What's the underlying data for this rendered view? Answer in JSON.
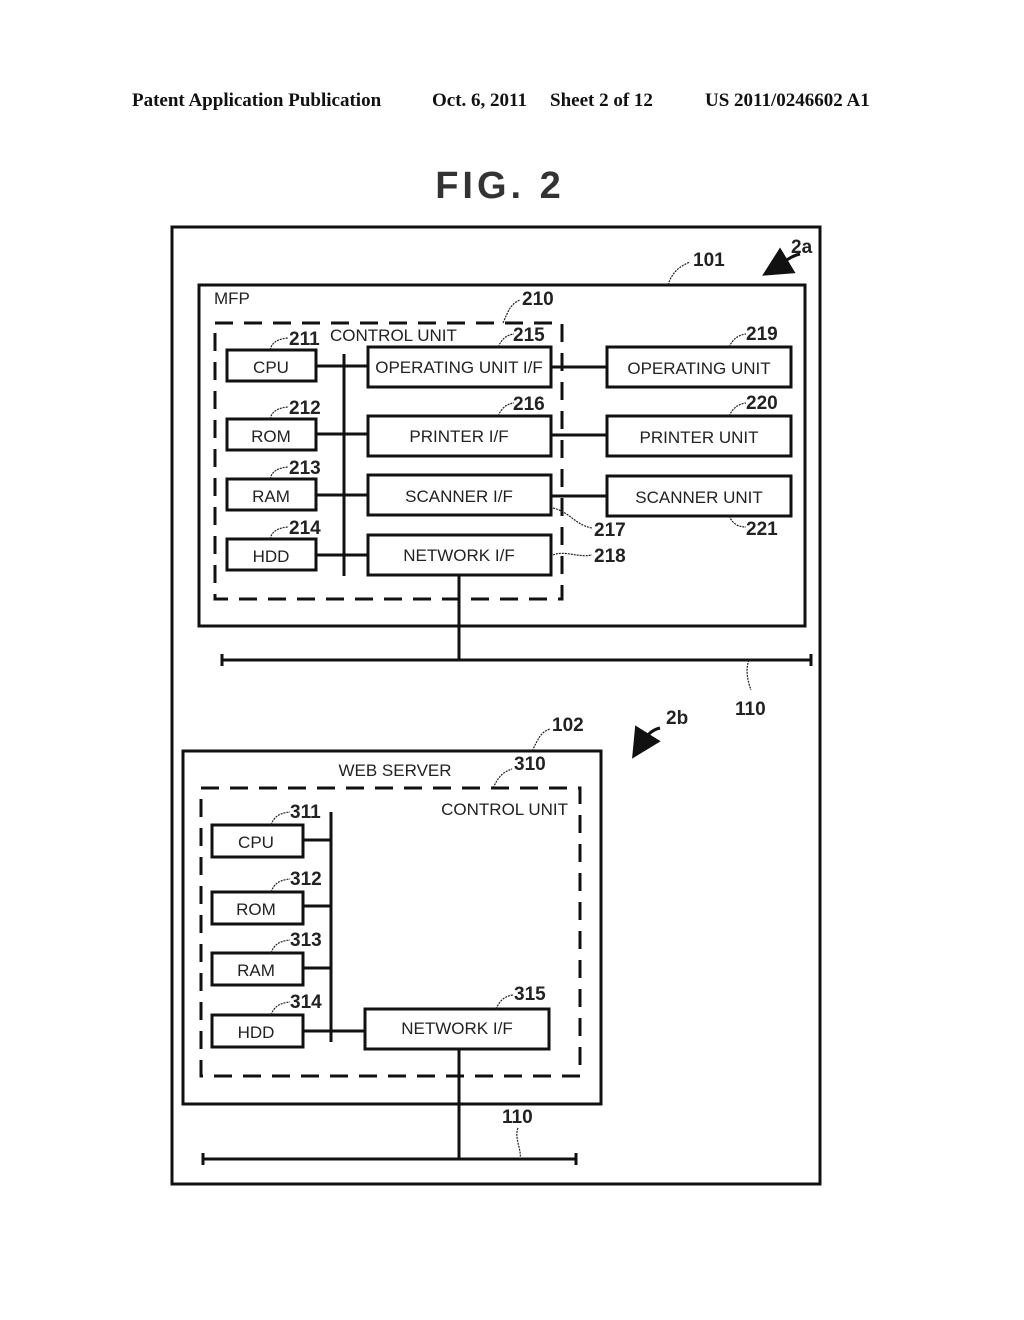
{
  "header": {
    "publication": "Patent Application Publication",
    "date": "Oct. 6, 2011",
    "sheet": "Sheet 2 of 12",
    "patent_number": "US 2011/0246602 A1"
  },
  "figure": {
    "title": "FIG. 2",
    "view_a": {
      "ref": "2a",
      "device": {
        "label": "MFP",
        "ref": "101"
      },
      "control_unit": {
        "label": "CONTROL UNIT",
        "ref": "210"
      },
      "components": [
        {
          "label": "CPU",
          "ref": "211"
        },
        {
          "label": "ROM",
          "ref": "212"
        },
        {
          "label": "RAM",
          "ref": "213"
        },
        {
          "label": "HDD",
          "ref": "214"
        }
      ],
      "interfaces": [
        {
          "label": "OPERATING UNIT I/F",
          "ref": "215"
        },
        {
          "label": "PRINTER I/F",
          "ref": "216"
        },
        {
          "label": "SCANNER I/F",
          "ref": "217"
        },
        {
          "label": "NETWORK I/F",
          "ref": "218"
        }
      ],
      "units": [
        {
          "label": "OPERATING UNIT",
          "ref": "219"
        },
        {
          "label": "PRINTER UNIT",
          "ref": "220"
        },
        {
          "label": "SCANNER UNIT",
          "ref": "221"
        }
      ],
      "network_ref": "110"
    },
    "view_b": {
      "ref": "2b",
      "device": {
        "label": "WEB SERVER",
        "ref": "102"
      },
      "control_unit": {
        "label": "CONTROL UNIT",
        "ref": "310"
      },
      "components": [
        {
          "label": "CPU",
          "ref": "311"
        },
        {
          "label": "ROM",
          "ref": "312"
        },
        {
          "label": "RAM",
          "ref": "313"
        },
        {
          "label": "HDD",
          "ref": "314"
        }
      ],
      "interfaces": [
        {
          "label": "NETWORK I/F",
          "ref": "315"
        }
      ],
      "network_ref": "110"
    }
  }
}
